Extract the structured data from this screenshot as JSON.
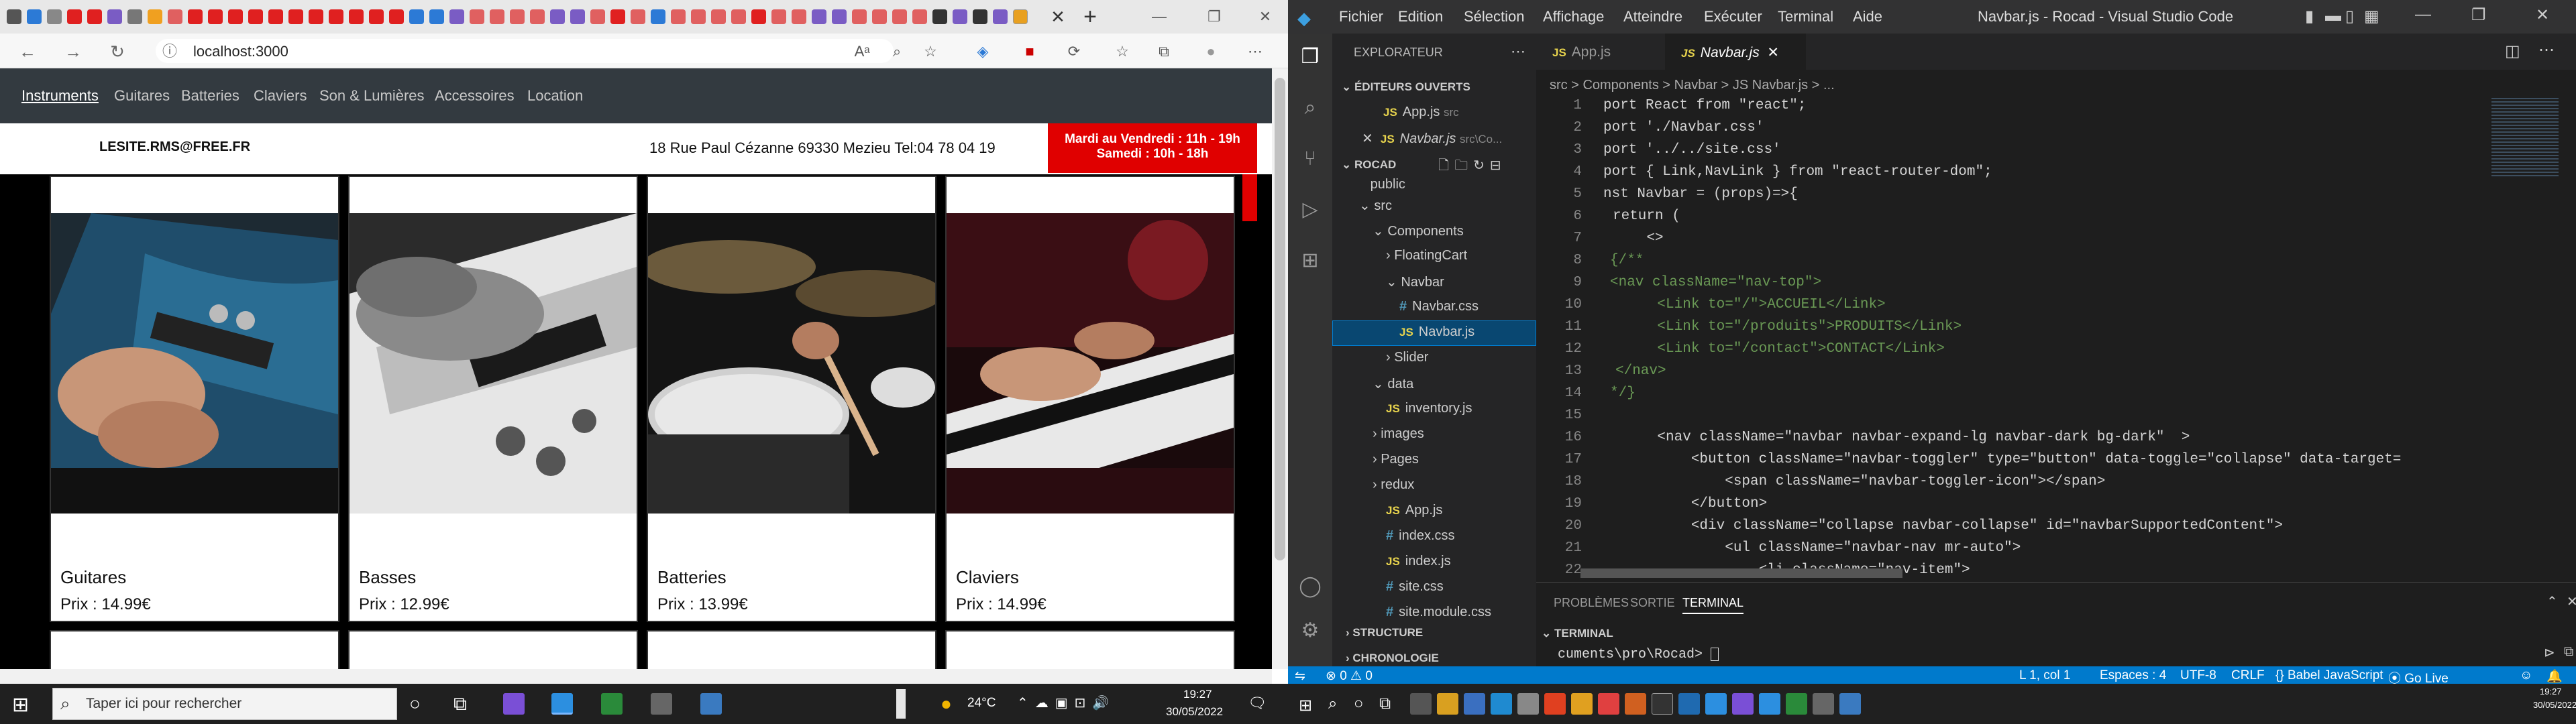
{
  "browser": {
    "url": "localhost:3000",
    "site": {
      "nav": [
        "Instruments",
        "Guitares",
        "Batteries",
        "Claviers",
        "Son & Lumières",
        "Accessoires",
        "Location"
      ],
      "email": "LESITE.RMS@FREE.FR",
      "address": "18 Rue Paul Cézanne 69330 Mezieu Tel:04 78 04 19",
      "hours_line1": "Mardi au Vendredi : 11h - 19h",
      "hours_line2": "Samedi : 10h - 18h",
      "products": [
        {
          "name": "Guitares",
          "price": "Prix : 14.99€"
        },
        {
          "name": "Basses",
          "price": "Prix : 12.99€"
        },
        {
          "name": "Batteries",
          "price": "Prix : 13.99€"
        },
        {
          "name": "Claviers",
          "price": "Prix : 14.99€"
        }
      ]
    }
  },
  "vscode": {
    "menu": [
      "Fichier",
      "Edition",
      "Sélection",
      "Affichage",
      "Atteindre",
      "Exécuter",
      "Terminal",
      "Aide"
    ],
    "title": "Navbar.js - Rocad - Visual Studio Code",
    "explorer_label": "EXPLORATEUR",
    "open_editors_label": "ÉDITEURS OUVERTS",
    "open_editors": [
      {
        "name": "App.js",
        "hint": "src"
      },
      {
        "name": "Navbar.js",
        "hint": "src\\Co..."
      }
    ],
    "project": "ROCAD",
    "tree": [
      "public",
      "src",
      "Components",
      "FloatingCart",
      "Navbar",
      "Navbar.css",
      "Navbar.js",
      "Slider",
      "data",
      "inventory.js",
      "images",
      "Pages",
      "redux",
      "App.js",
      "index.css",
      "index.js",
      "site.css",
      "site.module.css"
    ],
    "structure_label": "STRUCTURE",
    "timeline_label": "CHRONOLOGIE",
    "tabs": [
      "App.js",
      "Navbar.js"
    ],
    "breadcrumb": "src > Components > Navbar > JS Navbar.js > ...",
    "code_lines": [
      "port React from \"react\";",
      "port './Navbar.css'",
      "port '../../site.css'",
      "port { Link,NavLink } from \"react-router-dom\";",
      "nst Navbar = (props)=>{",
      "return (",
      "    <>",
      "{/**",
      "<nav className=\"nav-top\">",
      "    <Link to=\"/\">ACCUEIL</Link>",
      "    <Link to=\"/produits\">PRODUITS</Link>",
      "    <Link to=\"/contact\">CONTACT</Link>",
      "</nav>",
      "*/}",
      "",
      "    <nav className=\"navbar navbar-expand-lg navbar-dark bg-dark\"  >",
      "        <button className=\"navbar-toggler\" type=\"button\" data-toggle=\"collapse\" data-target=",
      "            <span className=\"navbar-toggler-icon\"></span>",
      "        </button>",
      "        <div className=\"collapse navbar-collapse\" id=\"navbarSupportedContent\">",
      "            <ul className=\"navbar-nav mr-auto\">",
      "                <li className=\"nav-item\">"
    ],
    "panel_tabs": [
      "PROBLÈMES",
      "SORTIE",
      "TERMINAL"
    ],
    "terminal_label": "TERMINAL",
    "terminal_prompt": "cuments\\pro\\Rocad>",
    "status": {
      "errors": "⊗ 0  ⚠ 0",
      "position": "L 1, col 1",
      "spaces": "Espaces : 4",
      "encoding": "UTF-8",
      "eol": "CRLF",
      "language": "{} Babel JavaScript",
      "golive": "⦿ Go Live"
    }
  },
  "taskbar": {
    "search_placeholder": "Taper ici pour rechercher",
    "weather": "24°C",
    "time": "19:27",
    "date": "30/05/2022",
    "time2": "19:27",
    "date2": "30/05/2022"
  },
  "colors": {
    "accent": "#007acc",
    "site_red": "#e00000",
    "vscode_bg": "#1e1e1e"
  }
}
